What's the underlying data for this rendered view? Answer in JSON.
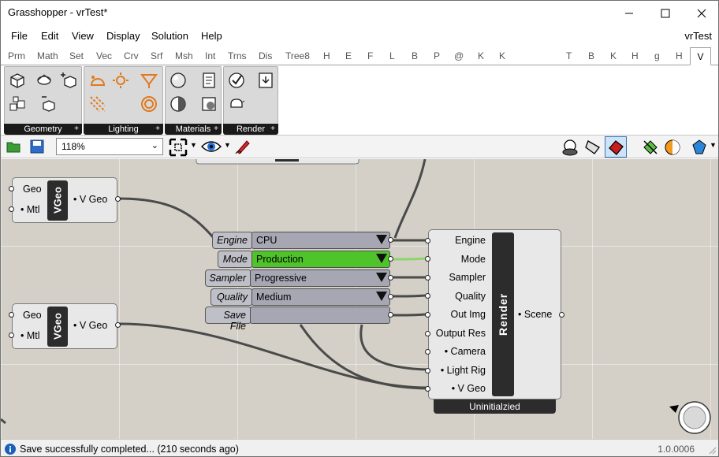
{
  "window": {
    "title": "Grasshopper - vrTest*"
  },
  "menu": {
    "items": [
      "File",
      "Edit",
      "View",
      "Display",
      "Solution",
      "Help"
    ],
    "document": "vrTest"
  },
  "tabs": [
    "Prm",
    "Math",
    "Set",
    "Vec",
    "Crv",
    "Srf",
    "Msh",
    "Int",
    "Trns",
    "Dis",
    "Tree8",
    "H",
    "E",
    "F",
    "L",
    "B",
    "P",
    "@",
    "K",
    "K",
    "T",
    "B",
    "K",
    "H",
    "g",
    "H",
    "V"
  ],
  "active_tab": "V",
  "ribbon": {
    "panels": [
      "Geometry",
      "Lighting",
      "Materials",
      "Render"
    ]
  },
  "toolbar": {
    "zoom": "118%"
  },
  "canvas": {
    "vgeo1": {
      "title": "VGeo",
      "inputs": [
        "Geo",
        "• Mtl"
      ],
      "output": "• V Geo"
    },
    "vgeo2": {
      "title": "VGeo",
      "inputs": [
        "Geo",
        "• Mtl"
      ],
      "output": "• V Geo"
    },
    "value_lists": [
      {
        "label": "Engine",
        "value": "CPU"
      },
      {
        "label": "Mode",
        "value": "Production"
      },
      {
        "label": "Sampler",
        "value": "Progressive"
      },
      {
        "label": "Quality",
        "value": "Medium"
      },
      {
        "label": "Save File",
        "value": ""
      }
    ],
    "render": {
      "title": "Render",
      "inputs": [
        "Engine",
        "Mode",
        "Sampler",
        "Quality",
        "Out Img",
        "Output Res",
        "• Camera",
        "• Light Rig",
        "• V Geo"
      ],
      "output": "• Scene",
      "status": "Uninitialzied"
    }
  },
  "status": {
    "message": "Save successfully completed... (210 seconds ago)",
    "version": "1.0.0006"
  },
  "colors": {
    "canvas": "#d4d0c8",
    "selected_value": "#4ec32a",
    "lighting_icon": "#e07a1f"
  }
}
